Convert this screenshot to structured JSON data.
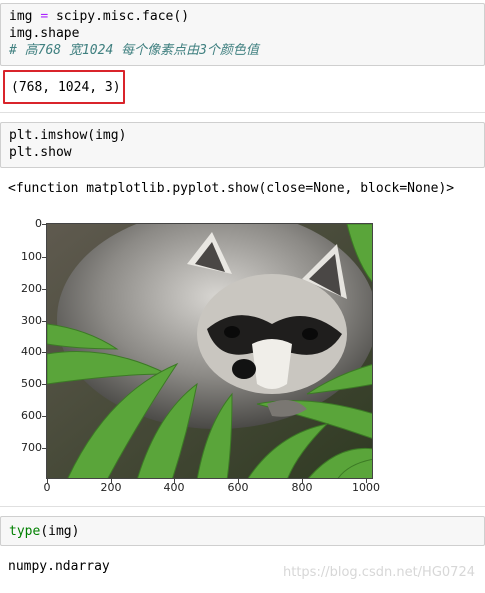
{
  "cell1": {
    "lines": [
      {
        "a": "img ",
        "op": "=",
        "b": " scipy.misc.face()"
      },
      {
        "text": "img.shape"
      },
      {
        "comment": "# 高768 宽1024 每个像素点由3个颜色值"
      }
    ],
    "output": "(768, 1024, 3)"
  },
  "cell2": {
    "lines": [
      "plt.imshow(img)",
      "plt.show"
    ],
    "output": "<function matplotlib.pyplot.show(close=None, block=None)>"
  },
  "plot": {
    "y_ticks": [
      "0",
      "100",
      "200",
      "300",
      "400",
      "500",
      "600",
      "700"
    ],
    "x_ticks": [
      "0",
      "200",
      "400",
      "600",
      "800",
      "1000"
    ],
    "image": "raccoon-face"
  },
  "cell3": {
    "builtin": "type",
    "rest": "(img)",
    "output": "numpy.ndarray"
  },
  "watermark": "https://blog.csdn.net/HG0724"
}
